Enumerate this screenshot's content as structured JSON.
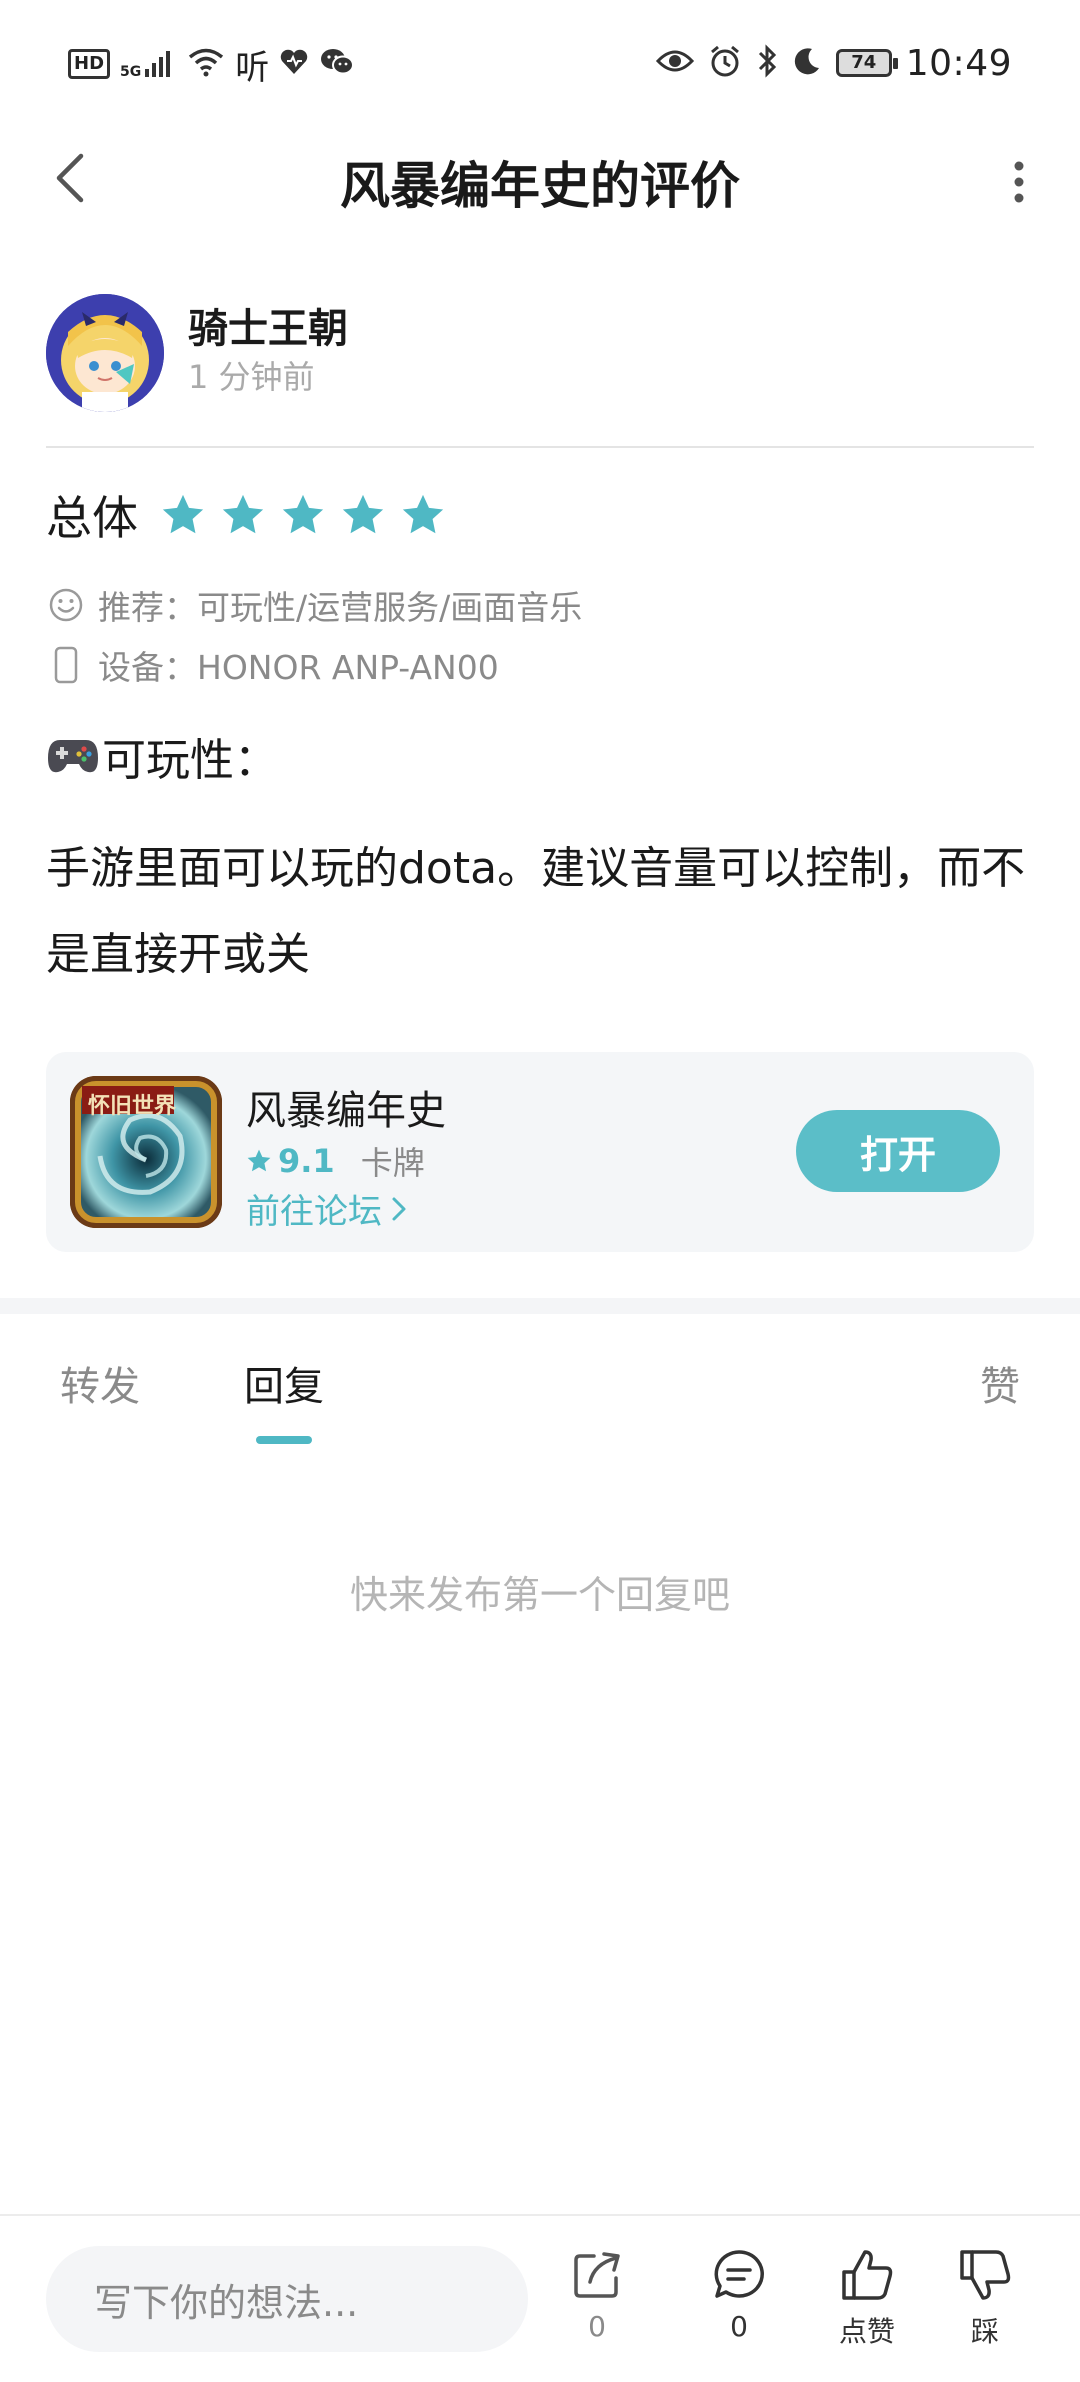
{
  "status_bar": {
    "time": "10:49",
    "battery": "74",
    "hd_label": "HD",
    "signal_label": "5G",
    "listen_label": "听",
    "icons": [
      "hd-icon",
      "signal-icon",
      "wifi-icon",
      "listen-icon",
      "health-icon",
      "wechat-icon",
      "eye-icon",
      "alarm-icon",
      "bluetooth-icon",
      "moon-icon",
      "battery-icon"
    ]
  },
  "header": {
    "title": "风暴编年史的评价"
  },
  "author": {
    "name": "骑士王朝",
    "time": "1 分钟前"
  },
  "rating": {
    "label": "总体",
    "stars": 5,
    "max_stars": 5,
    "star_color": "#4fb8c4"
  },
  "meta": {
    "recommend": "推荐：可玩性/运营服务/画面音乐",
    "device": "设备：HONOR ANP-AN00"
  },
  "review": {
    "section_emoji": "🎮",
    "section_title": "可玩性：",
    "body": "手游里面可以玩的dota。建议音量可以控制，而不是直接开或关"
  },
  "game_card": {
    "name": "风暴编年史",
    "score": "9.1",
    "genre": "卡牌",
    "forum_link": "前往论坛",
    "open_button": "打开",
    "icon_label": "怀旧世界",
    "accent": "#4fb8c4"
  },
  "tabs": [
    {
      "label": "转发",
      "active": false
    },
    {
      "label": "回复",
      "active": true
    },
    {
      "label": "赞",
      "active": false
    }
  ],
  "empty_state": "快来发布第一个回复吧",
  "bottom_bar": {
    "input_placeholder": "写下你的想法...",
    "share_count": "0",
    "comment_count": "0",
    "like_label": "点赞",
    "dislike_label": "踩"
  }
}
